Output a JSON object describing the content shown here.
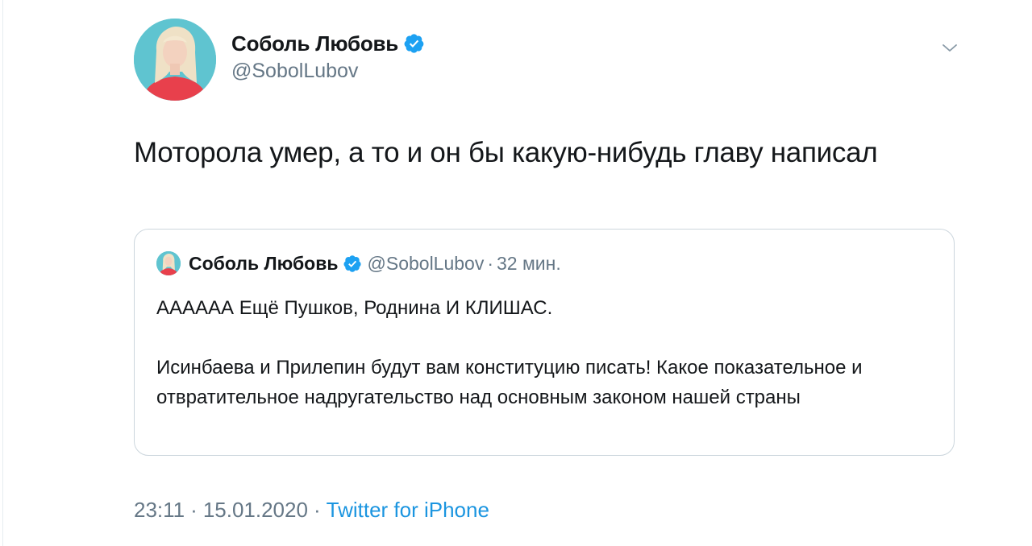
{
  "tweet": {
    "author_name": "Соболь Любовь",
    "author_handle": "@SobolLubov",
    "text": "Моторола умер, а то и он бы какую-нибудь главу написал",
    "time": "23:11",
    "date": "15.01.2020",
    "separator": "·",
    "source": "Twitter for iPhone"
  },
  "quoted": {
    "author_name": "Соболь Любовь",
    "author_handle": "@SobolLubov",
    "separator": "·",
    "time_ago": "32 мин.",
    "paragraph_1": "АААААА Ещё Пушков, Роднина И КЛИШАС.",
    "paragraph_2": "Исинбаева и Прилепин будут вам конституцию писать! Какое показательное и отвратительное надругательство над основным законом нашей страны"
  },
  "icons": {
    "verified": "verified-badge-icon",
    "menu": "chevron-down-icon"
  },
  "colors": {
    "accent": "#1da1f2",
    "link": "#1b95e0",
    "secondary_text": "#657786",
    "border": "#ccd6dd"
  }
}
